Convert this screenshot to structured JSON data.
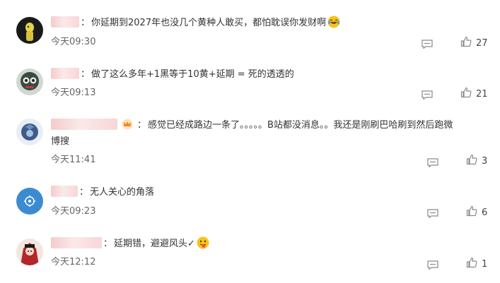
{
  "comments": [
    {
      "text": "你延期到2027年也没几个黄种人敢买，都怕耽误你发财啊",
      "time": "今天09:30",
      "likes": "27"
    },
    {
      "text": "做了这么多年+1黑等于10黄+延期 = 死的透透的",
      "time": "今天09:13",
      "likes": "21"
    },
    {
      "text_line1": "感觉已经成路边一条了。。。。。B站都没消息。。我还是刚刷巴哈刷到然后跑微",
      "text_line2": "博搜",
      "time": "今天11:41",
      "likes": "3"
    },
    {
      "text": "无人关心的角落",
      "time": "今天09:23",
      "likes": "6"
    },
    {
      "text": "延期错，避避风头✓",
      "time": "今天12:12",
      "likes": "1"
    }
  ],
  "icons": {
    "reply": "reply-icon",
    "like": "thumbs-up-icon",
    "vip_badge": "crown-badge-icon",
    "emoji_laugh": "laugh-cry-emoji",
    "emoji_tongue": "tongue-out-emoji"
  },
  "colors": {
    "text": "#333333",
    "meta": "#666666",
    "icon": "#8a8a8a"
  }
}
